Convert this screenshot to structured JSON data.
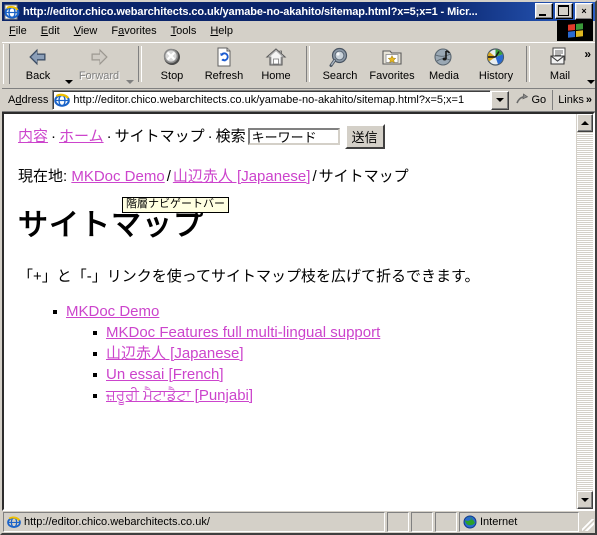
{
  "window": {
    "title": "http://editor.chico.webarchitects.co.uk/yamabe-no-akahito/sitemap.html?x=5;x=1 - Micr...",
    "title_icon": "ie-document-icon",
    "minimize_label": "",
    "maximize_label": "",
    "close_label": "×"
  },
  "menu": {
    "items": [
      {
        "label": "File",
        "accel": "F"
      },
      {
        "label": "Edit",
        "accel": "E"
      },
      {
        "label": "View",
        "accel": "V"
      },
      {
        "label": "Favorites",
        "accel": "a"
      },
      {
        "label": "Tools",
        "accel": "T"
      },
      {
        "label": "Help",
        "accel": "H"
      }
    ]
  },
  "toolbar": {
    "buttons": [
      {
        "label": "Back",
        "icon": "back-arrow-icon",
        "enabled": true,
        "has_menu": true
      },
      {
        "label": "Forward",
        "icon": "forward-arrow-icon",
        "enabled": false,
        "has_menu": true
      },
      {
        "label": "Stop",
        "icon": "stop-icon",
        "enabled": true,
        "has_menu": false
      },
      {
        "label": "Refresh",
        "icon": "refresh-icon",
        "enabled": true,
        "has_menu": false
      },
      {
        "label": "Home",
        "icon": "home-icon",
        "enabled": true,
        "has_menu": false
      },
      {
        "label": "Search",
        "icon": "search-icon",
        "enabled": true,
        "has_menu": false
      },
      {
        "label": "Favorites",
        "icon": "favorites-folder-icon",
        "enabled": true,
        "has_menu": false
      },
      {
        "label": "Media",
        "icon": "media-icon",
        "enabled": true,
        "has_menu": false
      },
      {
        "label": "History",
        "icon": "history-icon",
        "enabled": true,
        "has_menu": false
      },
      {
        "label": "Mail",
        "icon": "mail-icon",
        "enabled": true,
        "has_menu": true
      }
    ],
    "overflow_chevron": "»"
  },
  "address_bar": {
    "label": "Address",
    "url": "http://editor.chico.webarchitects.co.uk/yamabe-no-akahito/sitemap.html?x=5;x=1",
    "go_label": "Go",
    "links_label": "Links",
    "links_chevron": "»"
  },
  "page": {
    "nav": {
      "items": [
        {
          "label": "内容",
          "link": true
        },
        {
          "label": "ホーム",
          "link": true
        },
        {
          "label": "サイトマップ",
          "link": false
        },
        {
          "label": "検索",
          "link": false
        }
      ],
      "separator": "·"
    },
    "search": {
      "value": "キーワード",
      "placeholder": "キーワード",
      "submit_label": "送信"
    },
    "breadcrumb": {
      "label": "現在地:",
      "separator": "/",
      "items": [
        {
          "label": "MKDoc Demo",
          "link": true
        },
        {
          "label": "山辺赤人 [Japanese]",
          "link": true
        },
        {
          "label": "サイトマップ",
          "link": false
        }
      ]
    },
    "tooltip": "階層ナビゲートバー",
    "title": "サイトマップ",
    "intro": "「+」と「-」リンクを使ってサイトマップ枝を広げて折るできます。",
    "sitemap": {
      "root": "MKDoc Demo",
      "children": [
        "MKDoc Features full multi-lingual support",
        "山辺赤人 [Japanese]",
        "Un essai [French]",
        "ਜ਼ਰੂਰੀ ਮੈਟਾਡੈਟਾ [Punjabi]"
      ]
    }
  },
  "status_bar": {
    "url": "http://editor.chico.webarchitects.co.uk/",
    "zone": "Internet",
    "zone_icon": "globe-icon"
  },
  "colors": {
    "link": "#cc44cc",
    "titlebar": "#0a246a",
    "chrome": "#d4d0c8",
    "tooltip_bg": "#ffffe1"
  },
  "scrollbar": {
    "up_arrow": "▲",
    "down_arrow": "▼"
  }
}
